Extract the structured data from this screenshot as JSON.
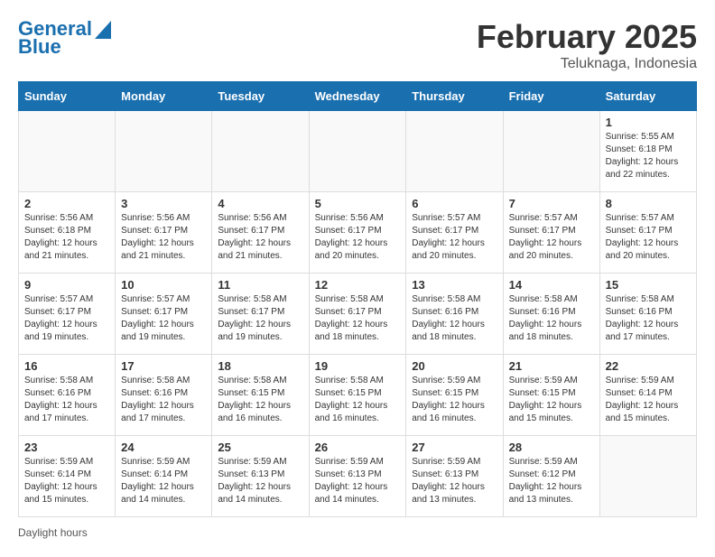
{
  "logo": {
    "line1": "General",
    "line2": "Blue"
  },
  "header": {
    "title": "February 2025",
    "subtitle": "Teluknaga, Indonesia"
  },
  "weekdays": [
    "Sunday",
    "Monday",
    "Tuesday",
    "Wednesday",
    "Thursday",
    "Friday",
    "Saturday"
  ],
  "weeks": [
    [
      {
        "day": "",
        "info": ""
      },
      {
        "day": "",
        "info": ""
      },
      {
        "day": "",
        "info": ""
      },
      {
        "day": "",
        "info": ""
      },
      {
        "day": "",
        "info": ""
      },
      {
        "day": "",
        "info": ""
      },
      {
        "day": "1",
        "info": "Sunrise: 5:55 AM\nSunset: 6:18 PM\nDaylight: 12 hours and 22 minutes."
      }
    ],
    [
      {
        "day": "2",
        "info": "Sunrise: 5:56 AM\nSunset: 6:18 PM\nDaylight: 12 hours and 21 minutes."
      },
      {
        "day": "3",
        "info": "Sunrise: 5:56 AM\nSunset: 6:17 PM\nDaylight: 12 hours and 21 minutes."
      },
      {
        "day": "4",
        "info": "Sunrise: 5:56 AM\nSunset: 6:17 PM\nDaylight: 12 hours and 21 minutes."
      },
      {
        "day": "5",
        "info": "Sunrise: 5:56 AM\nSunset: 6:17 PM\nDaylight: 12 hours and 20 minutes."
      },
      {
        "day": "6",
        "info": "Sunrise: 5:57 AM\nSunset: 6:17 PM\nDaylight: 12 hours and 20 minutes."
      },
      {
        "day": "7",
        "info": "Sunrise: 5:57 AM\nSunset: 6:17 PM\nDaylight: 12 hours and 20 minutes."
      },
      {
        "day": "8",
        "info": "Sunrise: 5:57 AM\nSunset: 6:17 PM\nDaylight: 12 hours and 20 minutes."
      }
    ],
    [
      {
        "day": "9",
        "info": "Sunrise: 5:57 AM\nSunset: 6:17 PM\nDaylight: 12 hours and 19 minutes."
      },
      {
        "day": "10",
        "info": "Sunrise: 5:57 AM\nSunset: 6:17 PM\nDaylight: 12 hours and 19 minutes."
      },
      {
        "day": "11",
        "info": "Sunrise: 5:58 AM\nSunset: 6:17 PM\nDaylight: 12 hours and 19 minutes."
      },
      {
        "day": "12",
        "info": "Sunrise: 5:58 AM\nSunset: 6:17 PM\nDaylight: 12 hours and 18 minutes."
      },
      {
        "day": "13",
        "info": "Sunrise: 5:58 AM\nSunset: 6:16 PM\nDaylight: 12 hours and 18 minutes."
      },
      {
        "day": "14",
        "info": "Sunrise: 5:58 AM\nSunset: 6:16 PM\nDaylight: 12 hours and 18 minutes."
      },
      {
        "day": "15",
        "info": "Sunrise: 5:58 AM\nSunset: 6:16 PM\nDaylight: 12 hours and 17 minutes."
      }
    ],
    [
      {
        "day": "16",
        "info": "Sunrise: 5:58 AM\nSunset: 6:16 PM\nDaylight: 12 hours and 17 minutes."
      },
      {
        "day": "17",
        "info": "Sunrise: 5:58 AM\nSunset: 6:16 PM\nDaylight: 12 hours and 17 minutes."
      },
      {
        "day": "18",
        "info": "Sunrise: 5:58 AM\nSunset: 6:15 PM\nDaylight: 12 hours and 16 minutes."
      },
      {
        "day": "19",
        "info": "Sunrise: 5:58 AM\nSunset: 6:15 PM\nDaylight: 12 hours and 16 minutes."
      },
      {
        "day": "20",
        "info": "Sunrise: 5:59 AM\nSunset: 6:15 PM\nDaylight: 12 hours and 16 minutes."
      },
      {
        "day": "21",
        "info": "Sunrise: 5:59 AM\nSunset: 6:15 PM\nDaylight: 12 hours and 15 minutes."
      },
      {
        "day": "22",
        "info": "Sunrise: 5:59 AM\nSunset: 6:14 PM\nDaylight: 12 hours and 15 minutes."
      }
    ],
    [
      {
        "day": "23",
        "info": "Sunrise: 5:59 AM\nSunset: 6:14 PM\nDaylight: 12 hours and 15 minutes."
      },
      {
        "day": "24",
        "info": "Sunrise: 5:59 AM\nSunset: 6:14 PM\nDaylight: 12 hours and 14 minutes."
      },
      {
        "day": "25",
        "info": "Sunrise: 5:59 AM\nSunset: 6:13 PM\nDaylight: 12 hours and 14 minutes."
      },
      {
        "day": "26",
        "info": "Sunrise: 5:59 AM\nSunset: 6:13 PM\nDaylight: 12 hours and 14 minutes."
      },
      {
        "day": "27",
        "info": "Sunrise: 5:59 AM\nSunset: 6:13 PM\nDaylight: 12 hours and 13 minutes."
      },
      {
        "day": "28",
        "info": "Sunrise: 5:59 AM\nSunset: 6:12 PM\nDaylight: 12 hours and 13 minutes."
      },
      {
        "day": "",
        "info": ""
      }
    ]
  ],
  "footer": {
    "text": "Daylight hours"
  }
}
